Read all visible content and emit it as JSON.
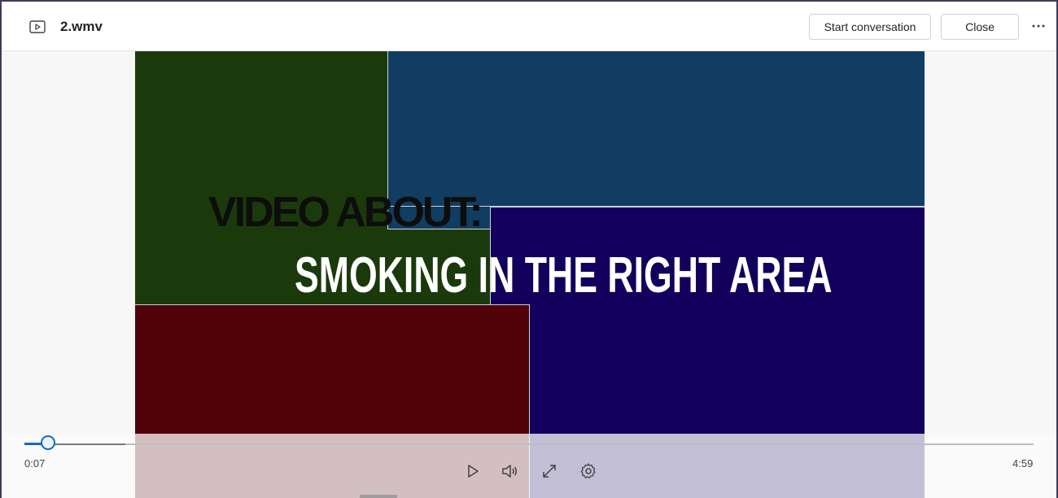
{
  "header": {
    "file_icon": "video-file-icon",
    "title": "2.wmv",
    "start_conversation_label": "Start conversation",
    "close_label": "Close",
    "more_icon": "more-horizontal-icon"
  },
  "video": {
    "line1": "VIDEO ABOUT:",
    "line2": "SMOKING  IN THE RIGHT AREA",
    "colors": {
      "green": "#1b3a0b",
      "blue": "#113d62",
      "purple": "#13005c",
      "red": "#510208"
    }
  },
  "player": {
    "current_time": "0:07",
    "total_time": "4:59",
    "progress_fraction": 0.023,
    "accent": "#0f6cbd",
    "icons": [
      "play-icon",
      "volume-icon",
      "fullscreen-icon",
      "settings-gear-icon"
    ]
  }
}
